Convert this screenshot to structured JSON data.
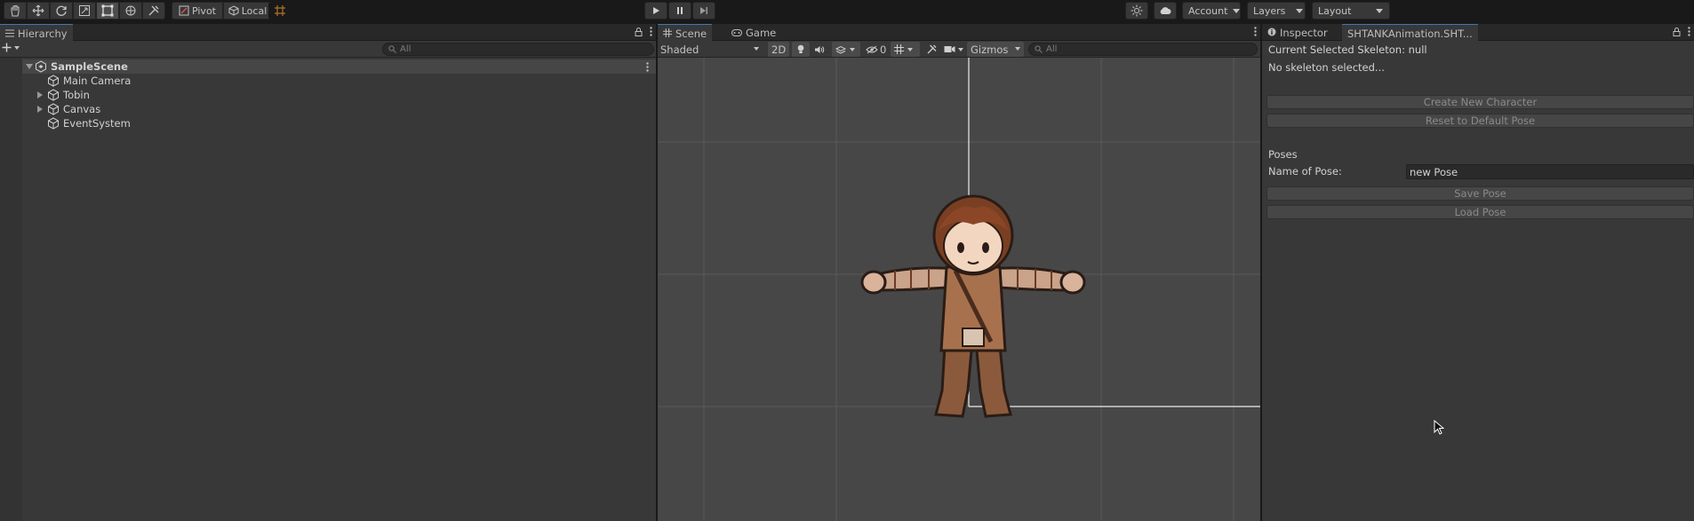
{
  "toolbar": {
    "tools": [
      "hand-tool",
      "move-tool",
      "rotate-tool",
      "scale-tool",
      "rect-tool",
      "transform-tool",
      "custom-tool"
    ],
    "pivot_label": "Pivot",
    "local_label": "Local",
    "account_label": "Account",
    "layers_label": "Layers",
    "layout_label": "Layout"
  },
  "hierarchy": {
    "tab_label": "Hierarchy",
    "search_placeholder": "All",
    "scene_name": "SampleScene",
    "items": [
      {
        "label": "Main Camera",
        "expandable": false
      },
      {
        "label": "Tobin",
        "expandable": true
      },
      {
        "label": "Canvas",
        "expandable": true
      },
      {
        "label": "EventSystem",
        "expandable": false
      }
    ]
  },
  "scene": {
    "tabs": [
      {
        "label": "Scene",
        "icon": "grid-icon"
      },
      {
        "label": "Game",
        "icon": "gamepad-icon"
      }
    ],
    "shading_mode": "Shaded",
    "mode_2d_label": "2D",
    "hidden_count": "0",
    "gizmos_label": "Gizmos",
    "search_placeholder": "All"
  },
  "inspector": {
    "tabs": [
      {
        "label": "Inspector",
        "icon": "info-icon"
      },
      {
        "label": "SHTANKAnimation.SHT..."
      }
    ],
    "skeleton_status": "Current Selected Skeleton: null",
    "no_skeleton": "No skeleton selected...",
    "create_button": "Create New Character",
    "reset_button": "Reset to Default Pose",
    "poses_header": "Poses",
    "pose_name_label": "Name of Pose:",
    "pose_name_value": "new Pose",
    "save_button": "Save Pose",
    "load_button": "Load Pose"
  },
  "colors": {
    "accent": "#3a79bb",
    "panel_bg": "#383838",
    "toolbar_bg": "#191919",
    "scene_bg": "#474747"
  }
}
